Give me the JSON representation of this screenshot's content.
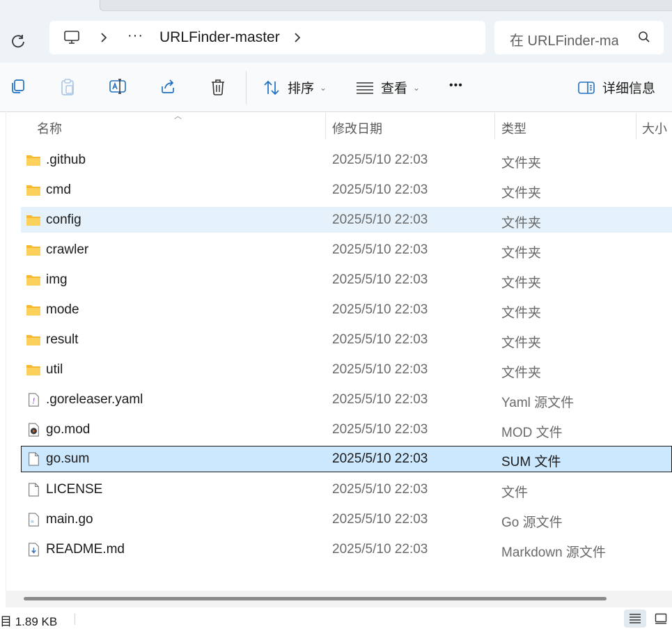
{
  "address_bar": {
    "overflow_label": "···",
    "crumb": "URLFinder-master",
    "search_placeholder": "在 URLFinder-master 中搜索"
  },
  "toolbar": {
    "sort_label": "排序",
    "view_label": "查看",
    "more_label": "•••",
    "details_label": "详细信息"
  },
  "columns": {
    "name": "名称",
    "date": "修改日期",
    "type": "类型",
    "size": "大小"
  },
  "files": [
    {
      "name": ".github",
      "date": "2025/5/10 22:03",
      "type": "文件夹",
      "icon": "folder-icon"
    },
    {
      "name": "cmd",
      "date": "2025/5/10 22:03",
      "type": "文件夹",
      "icon": "folder-icon"
    },
    {
      "name": "config",
      "date": "2025/5/10 22:03",
      "type": "文件夹",
      "icon": "folder-icon",
      "state": "hover"
    },
    {
      "name": "crawler",
      "date": "2025/5/10 22:03",
      "type": "文件夹",
      "icon": "folder-icon"
    },
    {
      "name": "img",
      "date": "2025/5/10 22:03",
      "type": "文件夹",
      "icon": "folder-icon"
    },
    {
      "name": "mode",
      "date": "2025/5/10 22:03",
      "type": "文件夹",
      "icon": "folder-icon"
    },
    {
      "name": "result",
      "date": "2025/5/10 22:03",
      "type": "文件夹",
      "icon": "folder-icon"
    },
    {
      "name": "util",
      "date": "2025/5/10 22:03",
      "type": "文件夹",
      "icon": "folder-icon"
    },
    {
      "name": ".goreleaser.yaml",
      "date": "2025/5/10 22:03",
      "type": "Yaml 源文件",
      "icon": "yaml-file-icon"
    },
    {
      "name": "go.mod",
      "date": "2025/5/10 22:03",
      "type": "MOD 文件",
      "icon": "media-file-icon"
    },
    {
      "name": "go.sum",
      "date": "2025/5/10 22:03",
      "type": "SUM 文件",
      "icon": "blank-file-icon",
      "state": "selected"
    },
    {
      "name": "LICENSE",
      "date": "2025/5/10 22:03",
      "type": "文件",
      "icon": "blank-file-icon"
    },
    {
      "name": "main.go",
      "date": "2025/5/10 22:03",
      "type": "Go 源文件",
      "icon": "go-file-icon"
    },
    {
      "name": "README.md",
      "date": "2025/5/10 22:03",
      "type": "Markdown 源文件",
      "icon": "markdown-file-icon"
    }
  ],
  "status": {
    "selection_text": "目  1.89 KB"
  },
  "colors": {
    "selected_bg": "#cce8ff",
    "hover_bg": "#e5f1fb",
    "folder_yellow": "#f8c94a",
    "accent_blue": "#1f6fbf"
  }
}
